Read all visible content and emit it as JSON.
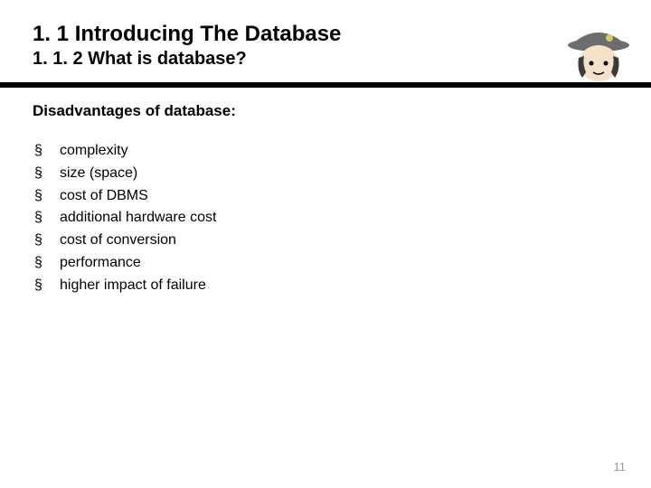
{
  "header": {
    "title": "1. 1 Introducing The Database",
    "subtitle": "1. 1. 2 What is database?"
  },
  "section_heading": "Disadvantages of database:",
  "bullets": [
    "complexity",
    "size (space)",
    "cost of DBMS",
    "additional hardware cost",
    "cost of conversion",
    "performance",
    "higher impact of failure"
  ],
  "page_number": "11"
}
